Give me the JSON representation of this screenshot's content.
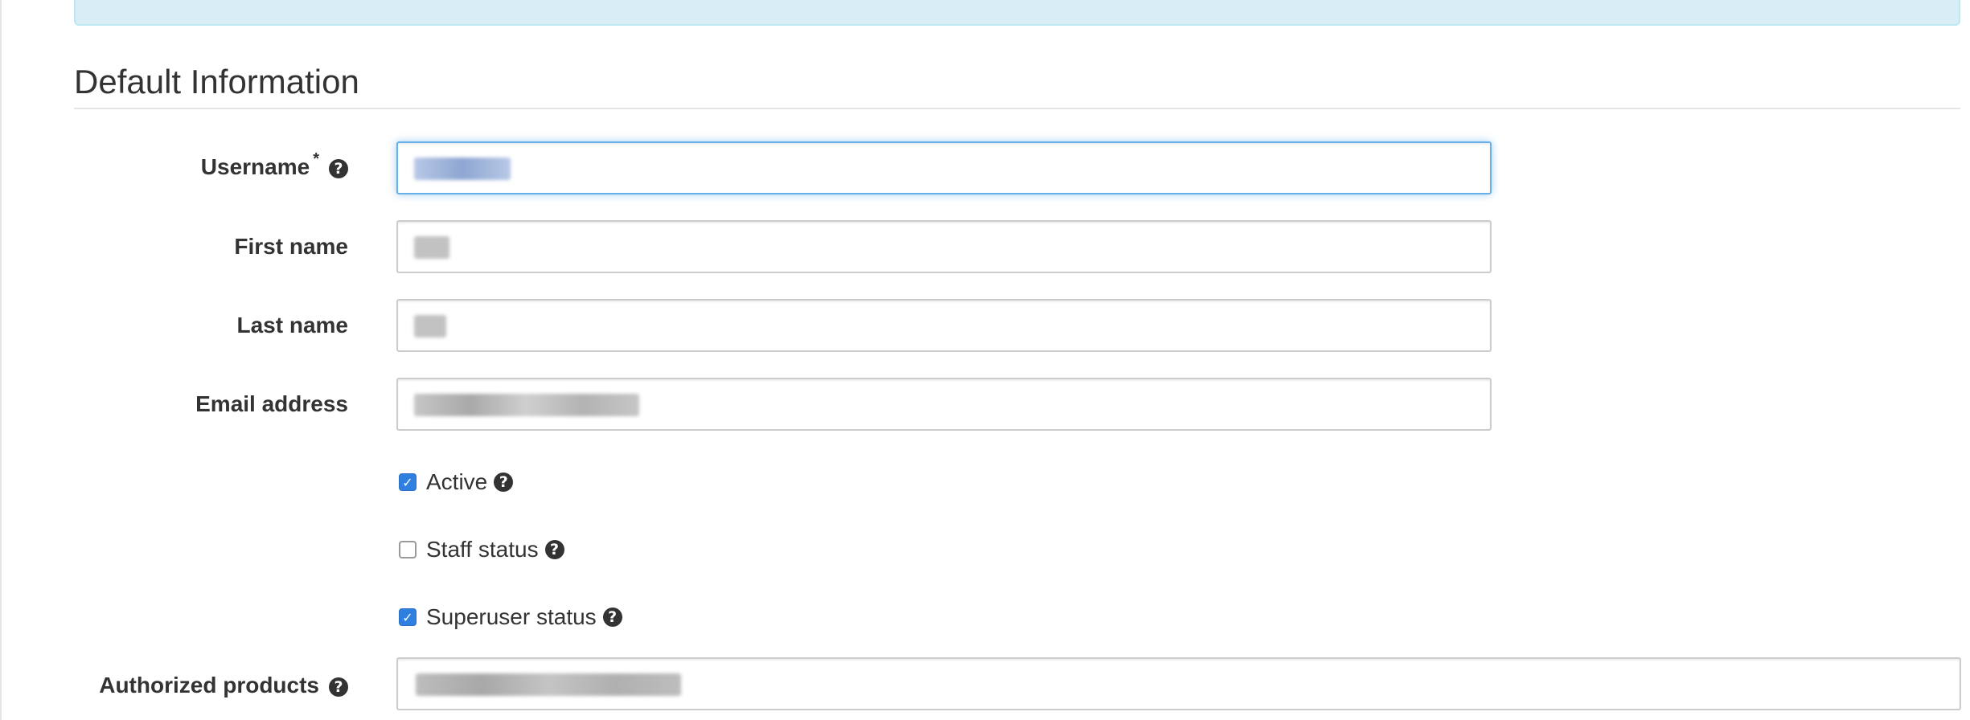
{
  "section": {
    "title": "Default Information"
  },
  "fields": {
    "username": {
      "label": "Username",
      "required_mark": "*"
    },
    "first_name": {
      "label": "First name"
    },
    "last_name": {
      "label": "Last name"
    },
    "email": {
      "label": "Email address"
    },
    "authorized_products": {
      "label": "Authorized products"
    }
  },
  "checkboxes": {
    "active": {
      "label": "Active",
      "checked": true
    },
    "staff": {
      "label": "Staff status",
      "checked": false
    },
    "superuser": {
      "label": "Superuser status",
      "checked": true
    }
  },
  "icons": {
    "help": "question-circle-icon",
    "check": "checkmark-icon"
  },
  "glyphs": {
    "help": "?",
    "check": "✓"
  },
  "colors": {
    "focus_border": "#66afe9",
    "checkbox_checked": "#2f7fe0",
    "info_banner": "#d9edf7"
  }
}
